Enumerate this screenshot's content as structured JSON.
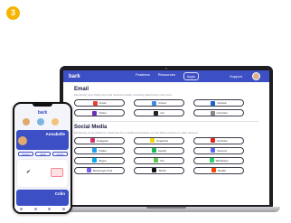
{
  "step_number": "3",
  "web": {
    "logo": "bark",
    "nav_links": [
      "Features",
      "Resources",
      "Apps"
    ],
    "nav_right": "Support",
    "email": {
      "title": "Email",
      "description": "Monitoring your child's sent and received emails, including attachments and more.",
      "services": [
        {
          "label": "Gmail",
          "icon": "gmail-icon",
          "color": "#ea4335"
        },
        {
          "label": "iCloud",
          "icon": "icloud-icon",
          "color": "#3d8be8"
        },
        {
          "label": "Outlook",
          "icon": "outlook-icon",
          "color": "#1a64c8"
        },
        {
          "label": "Yahoo",
          "icon": "yahoo-icon",
          "color": "#6b2fb8"
        },
        {
          "label": "Aol",
          "icon": "aol-icon",
          "color": "#222222"
        },
        {
          "label": "Comcast",
          "icon": "comcast-icon",
          "color": "#888888"
        }
      ]
    },
    "social": {
      "title": "Social Media",
      "description": "Monitoring some platforms. Click here for a detailed description on how Bark monitors on each account.",
      "services": [
        {
          "label": "Instagram",
          "icon": "instagram-icon",
          "color": "#d6336c"
        },
        {
          "label": "Snapchat",
          "icon": "snapchat-icon",
          "color": "#f5d800"
        },
        {
          "label": "YouTube",
          "icon": "youtube-icon",
          "color": "#e62117"
        },
        {
          "label": "Twitter",
          "icon": "twitter-icon",
          "color": "#1da1f2"
        },
        {
          "label": "Spotify",
          "icon": "spotify-icon",
          "color": "#1db954"
        },
        {
          "label": "Discord",
          "icon": "discord-icon",
          "color": "#5865f2"
        },
        {
          "label": "Skype",
          "icon": "skype-icon",
          "color": "#00aff0"
        },
        {
          "label": "Kik",
          "icon": "kik-icon",
          "color": "#60c84d"
        },
        {
          "label": "WhatsApp",
          "icon": "whatsapp-icon",
          "color": "#25d366"
        },
        {
          "label": "Messenger Kids",
          "icon": "messenger-kids-icon",
          "color": "#7b5cf5"
        },
        {
          "label": "TikTok",
          "icon": "tiktok-icon",
          "color": "#111111"
        },
        {
          "label": "Reddit",
          "icon": "reddit-icon",
          "color": "#ff4500"
        }
      ]
    }
  },
  "phone": {
    "logo": "bark",
    "child_1": "Annabelle",
    "tabs": [
      "Settings",
      "Alerts",
      "Activity"
    ],
    "child_2": "Colin",
    "avatar_colors": [
      "#e0a96d",
      "#7fb3e0",
      "#f3c37a"
    ]
  },
  "colors": {
    "brand": "#3d4fc4",
    "accent": "#f5b400"
  }
}
